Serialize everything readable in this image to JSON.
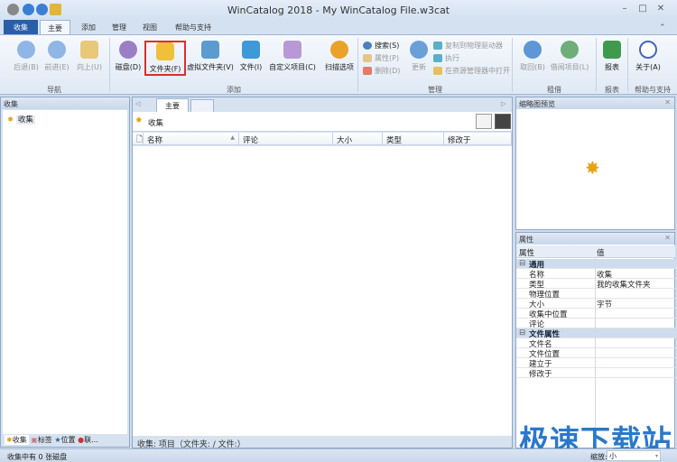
{
  "window": {
    "title": "WinCatalog 2018 - My WinCatalog File.w3cat"
  },
  "ribbon_tabs": [
    "收集",
    "主要",
    "添加",
    "管理",
    "视图",
    "帮助与支持"
  ],
  "ribbon": {
    "nav": {
      "label": "导航",
      "back": "后退(B)",
      "forward": "前进(E)",
      "up": "向上(U)"
    },
    "add": {
      "label": "添加",
      "disk": "磁盘(D)",
      "folder": "文件夹(F)",
      "virtual_folder": "虚拟文件夹(V)",
      "file": "文件(I)",
      "custom": "自定义项目(C)",
      "scan": "扫描选项"
    },
    "manage": {
      "label": "管理",
      "search": "搜索(S)",
      "properties": "属性(P)",
      "delete": "删除(D)",
      "update": "更新",
      "copy_to_drive": "复制到物理驱动器",
      "execute": "执行",
      "open_explorer": "在资源管理器中打开"
    },
    "lend": {
      "label": "租借",
      "return": "取回(B)",
      "borrow": "借阅项目(L)"
    },
    "report": {
      "label": "报表",
      "report": "报表"
    },
    "help": {
      "label": "帮助与支持",
      "about": "关于(A)"
    }
  },
  "left_pane": {
    "title": "收集",
    "tree": [
      "收集"
    ],
    "bottom_tabs": [
      "收集",
      "标签",
      "位置",
      "联..."
    ]
  },
  "center": {
    "tabs": [
      "主要"
    ],
    "path": "收集",
    "columns": [
      "名称",
      "评论",
      "大小",
      "类型",
      "修改于"
    ],
    "footer": "收集:  项目（文件夹:  / 文件:）"
  },
  "thumbnail": {
    "title": "缩略图预览"
  },
  "properties": {
    "title": "属性",
    "col_prop": "属性",
    "col_value": "值",
    "groups": [
      {
        "name": "通用",
        "rows": [
          [
            "名称",
            "收集"
          ],
          [
            "类型",
            "我的收集文件夹"
          ],
          [
            "物理位置",
            ""
          ],
          [
            "大小",
            " 字节"
          ],
          [
            "收集中位置",
            ""
          ],
          [
            "评论",
            ""
          ]
        ]
      },
      {
        "name": "文件属性",
        "rows": [
          [
            "文件名",
            ""
          ],
          [
            "文件位置",
            ""
          ],
          [
            "建立于",
            ""
          ],
          [
            "修改于",
            ""
          ]
        ]
      }
    ]
  },
  "watermark": "极速下载站",
  "status": {
    "text": "收集中有 0 张磁盘",
    "zoom_label": "缩放:",
    "zoom_value": "小"
  },
  "colors": {
    "accent": "#2a5ea8",
    "highlight": "#d9302c",
    "watermark": "#2b78c9"
  }
}
